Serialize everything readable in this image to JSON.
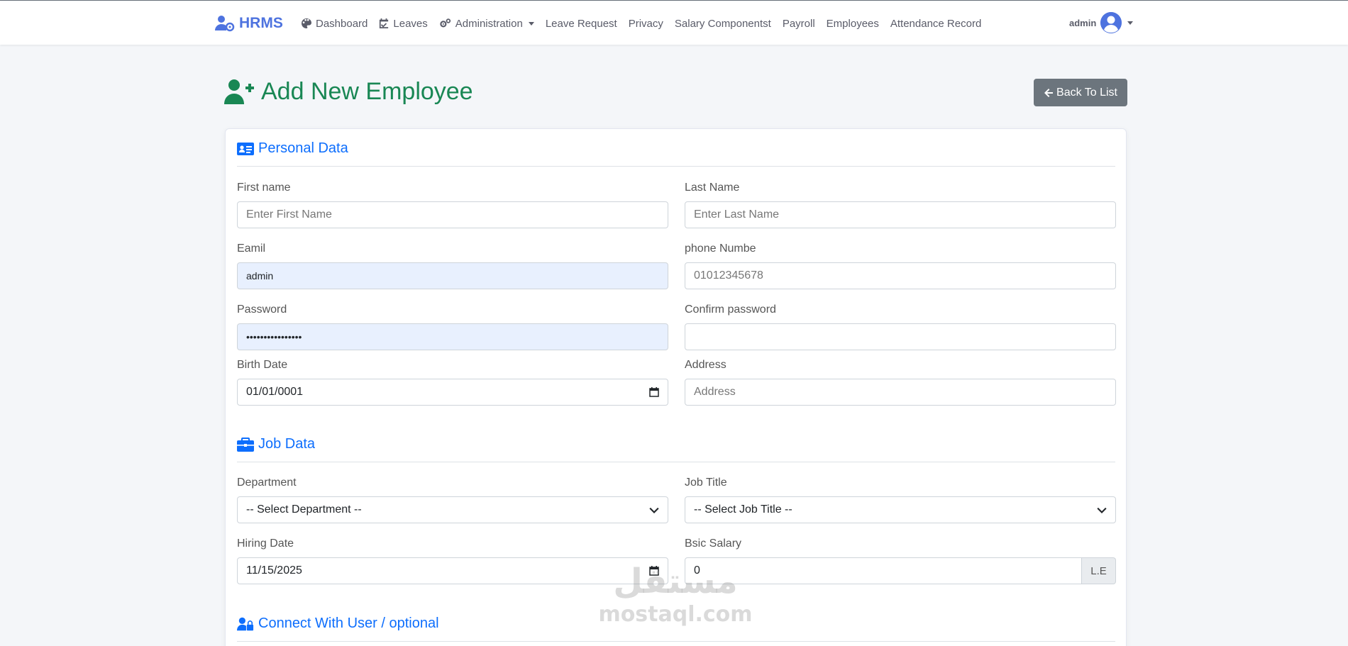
{
  "nav": {
    "brand": "HRMS",
    "items": [
      {
        "label": "Dashboard",
        "icon": "palette-icon"
      },
      {
        "label": "Leaves",
        "icon": "calendar-check-icon"
      },
      {
        "label": "Administration",
        "icon": "gears-icon",
        "dropdown": true
      },
      {
        "label": "Leave Request"
      },
      {
        "label": "Privacy"
      },
      {
        "label": "Salary Componentst"
      },
      {
        "label": "Payroll"
      },
      {
        "label": "Employees"
      },
      {
        "label": "Attendance Record"
      }
    ],
    "user": "admin"
  },
  "page": {
    "title": "Add New Employee",
    "back_label": "Back To List"
  },
  "personal": {
    "heading": "Personal Data",
    "first_name_label": "First name",
    "first_name_placeholder": "Enter First Name",
    "last_name_label": "Last Name",
    "last_name_placeholder": "Enter Last Name",
    "email_label": "Eamil",
    "email_value": "admin",
    "phone_label": "phone Numbe",
    "phone_placeholder": "01012345678",
    "password_label": "Password",
    "password_value": "••••••••••••••••",
    "confirm_label": "Confirm password",
    "confirm_value": "",
    "birth_label": "Birth Date",
    "birth_value": "01/01/0001",
    "address_label": "Address",
    "address_placeholder": "Address"
  },
  "job": {
    "heading": "Job Data",
    "department_label": "Department",
    "department_value": "-- Select Department --",
    "job_title_label": "Job Title",
    "job_title_value": "-- Select Job Title --",
    "hiring_label": "Hiring Date",
    "hiring_value": "11/15/2025",
    "salary_label": "Bsic Salary",
    "salary_value": "0",
    "salary_unit": "L.E"
  },
  "connect": {
    "heading": "Connect With User / optional"
  },
  "watermark": {
    "arabic": "مستقل",
    "latin": "mostaql.com"
  }
}
